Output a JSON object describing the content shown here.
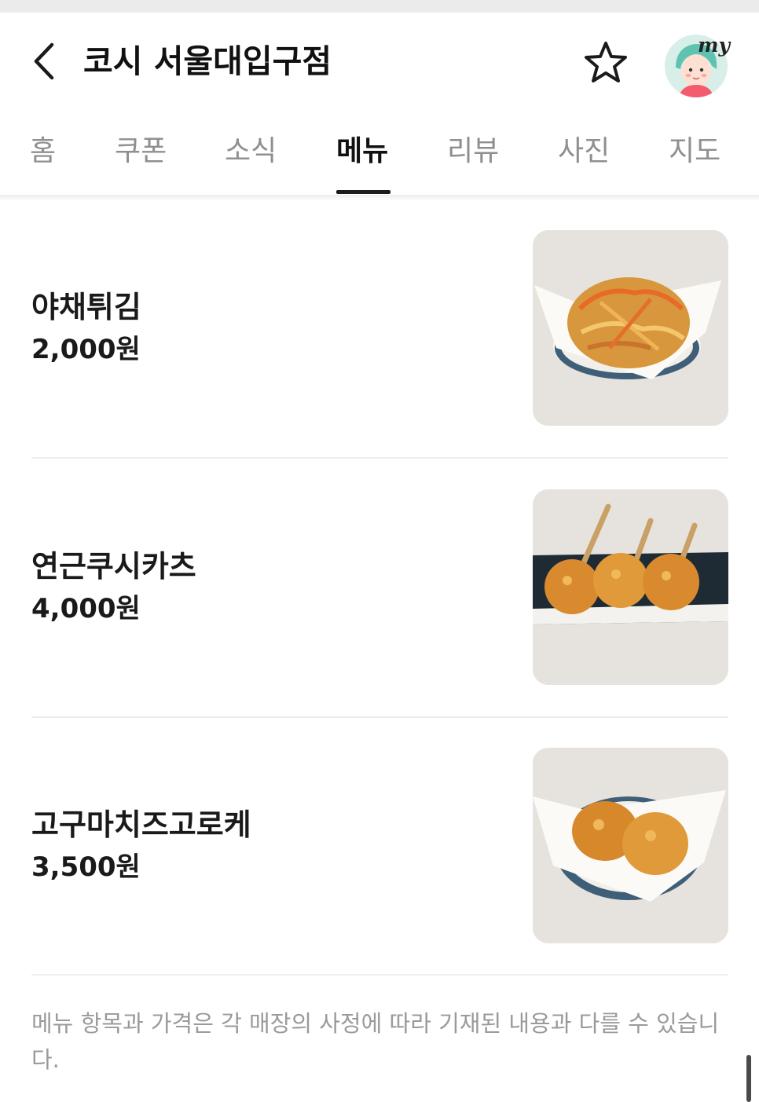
{
  "header": {
    "title": "코시 서울대입구점",
    "my_label": "my"
  },
  "tabs": [
    {
      "label": "홈",
      "active": false
    },
    {
      "label": "쿠폰",
      "active": false
    },
    {
      "label": "소식",
      "active": false
    },
    {
      "label": "메뉴",
      "active": true
    },
    {
      "label": "리뷰",
      "active": false
    },
    {
      "label": "사진",
      "active": false
    },
    {
      "label": "지도",
      "active": false
    }
  ],
  "menu": [
    {
      "name": "야채튀김",
      "price": "2,000원"
    },
    {
      "name": "연근쿠시카츠",
      "price": "4,000원"
    },
    {
      "name": "고구마치즈고로케",
      "price": "3,500원"
    }
  ],
  "notice": "메뉴 항목과 가격은 각 매장의 사정에 따라 기재된 내용과 다를 수 있습니다.",
  "colors": {
    "accent_text": "#1a1a1a",
    "inactive_tab": "#8f8f8f",
    "notice_text": "#9a9a9a"
  }
}
